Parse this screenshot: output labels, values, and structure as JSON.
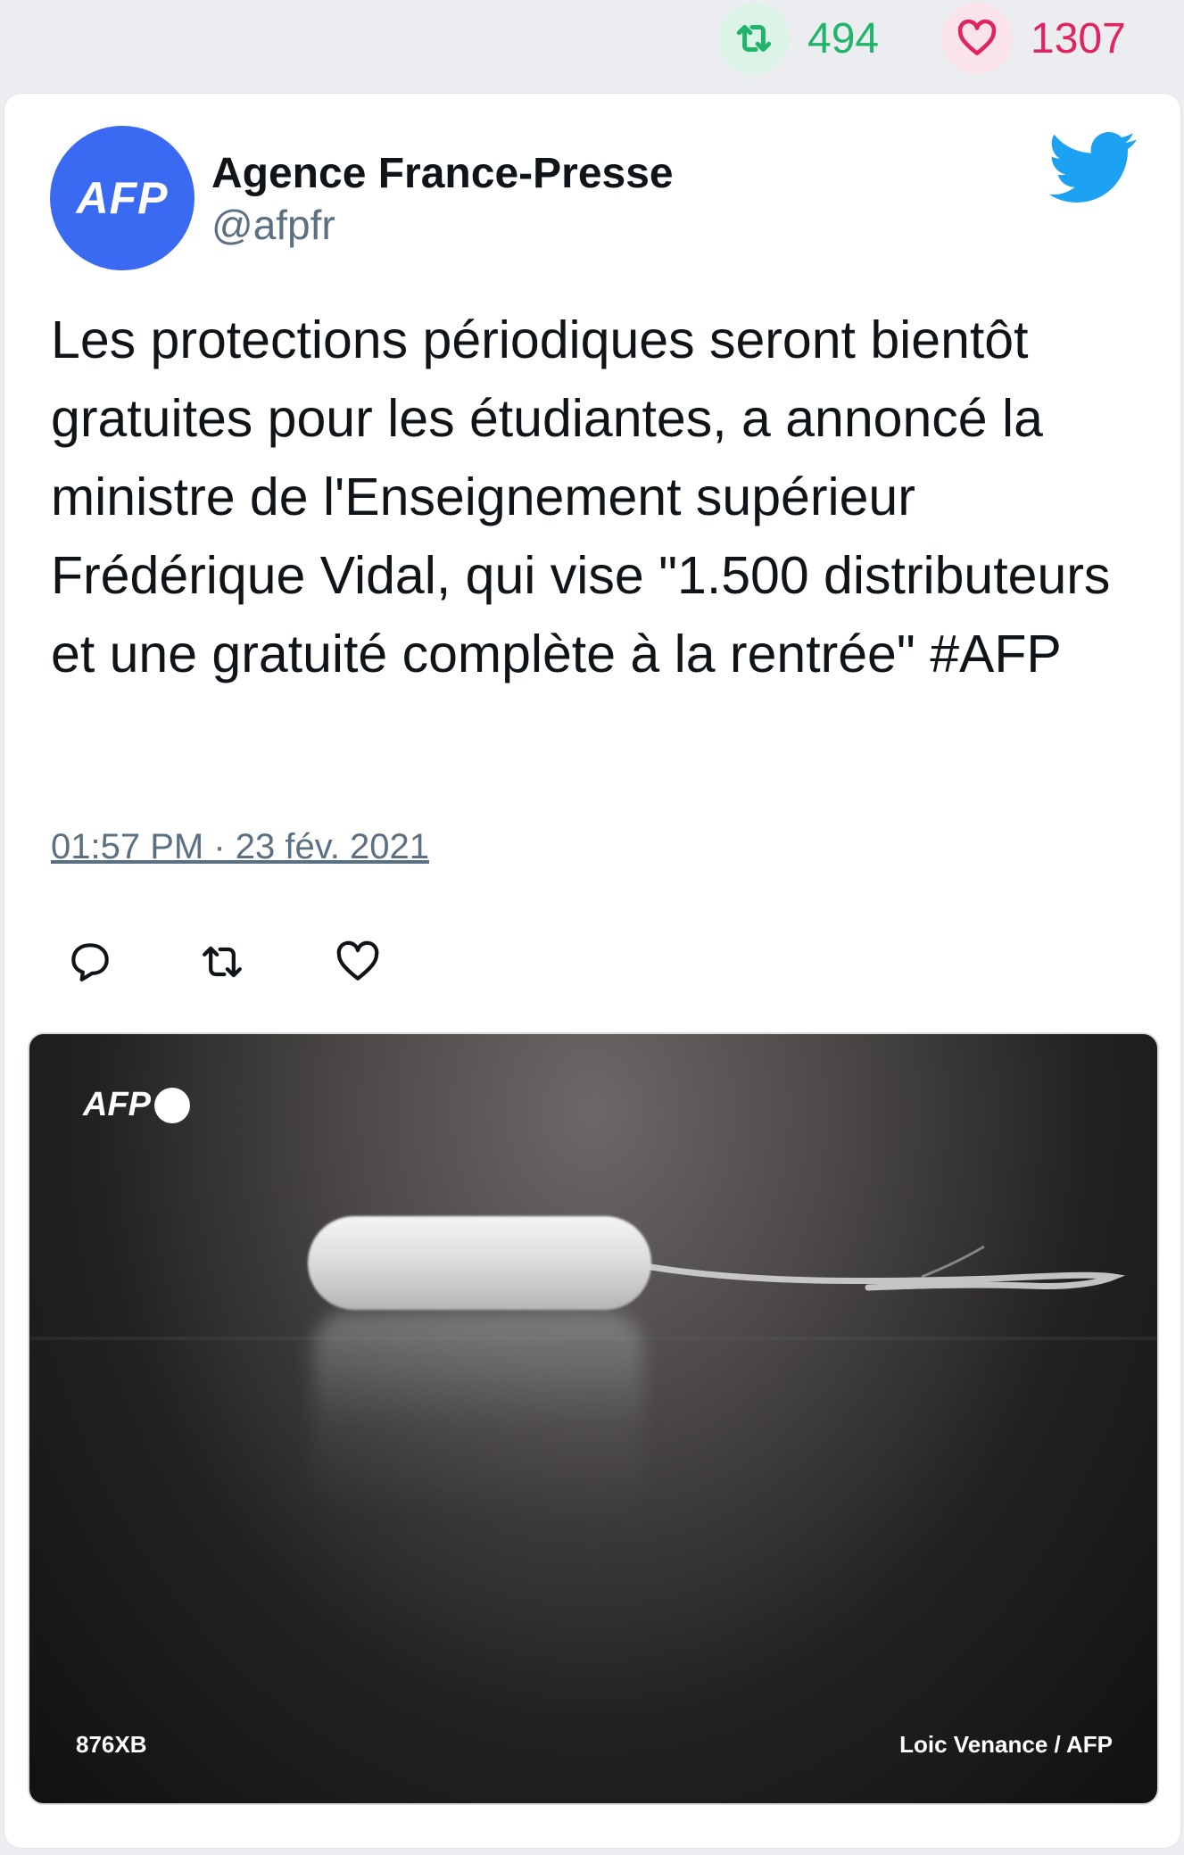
{
  "stats": {
    "retweet_count": "494",
    "like_count": "1307"
  },
  "tweet": {
    "avatar_text": "AFP",
    "author_name": "Agence France-Presse",
    "author_handle": "@afpfr",
    "text": "Les protections périodiques seront bientôt gratuites pour les étudiantes, a annoncé la ministre de l'Enseignement supérieur Frédérique Vidal, qui vise \"1.500 distributeurs et une gratuité complète à la rentrée\" #AFP",
    "timestamp": "01:57 PM · 23 fév. 2021"
  },
  "media": {
    "watermark": "AFP",
    "photo_id": "876XB",
    "credit": "Loic Venance / AFP"
  },
  "colors": {
    "retweet_green": "#21b56b",
    "like_red": "#e0245e",
    "twitter_blue": "#1da1f2",
    "avatar_blue": "#3b6af2",
    "handle_gray": "#5b7083"
  },
  "icons": {
    "stat_retweet": "retweet-icon",
    "stat_like": "heart-icon",
    "brand": "twitter-bird-icon",
    "action_reply": "reply-icon",
    "action_retweet": "retweet-icon",
    "action_like": "heart-icon"
  }
}
